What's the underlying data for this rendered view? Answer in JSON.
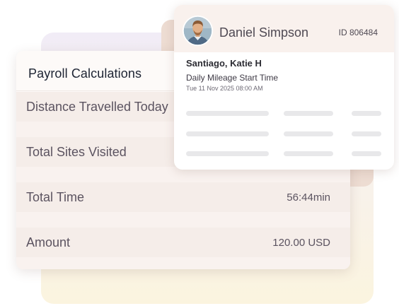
{
  "payroll": {
    "title": "Payroll Calculations",
    "rows": [
      {
        "label": "Distance Travelled Today",
        "value": ""
      },
      {
        "label": "Total Sites Visited",
        "value": ""
      },
      {
        "label": "Total Time",
        "value": "56:44min"
      },
      {
        "label": "Amount",
        "value": "120.00 USD"
      }
    ]
  },
  "profile": {
    "name": "Daniel Simpson",
    "id": "ID 806484",
    "subtitle": "Santiago, Katie H",
    "event": "Daily Mileage Start Time",
    "timestamp": "Tue 11 Nov 2025 08:00 AM"
  },
  "colors": {
    "accent_panel": "#eddcd2",
    "row_background": "#f5ede9",
    "text_primary": "#5b5360"
  }
}
